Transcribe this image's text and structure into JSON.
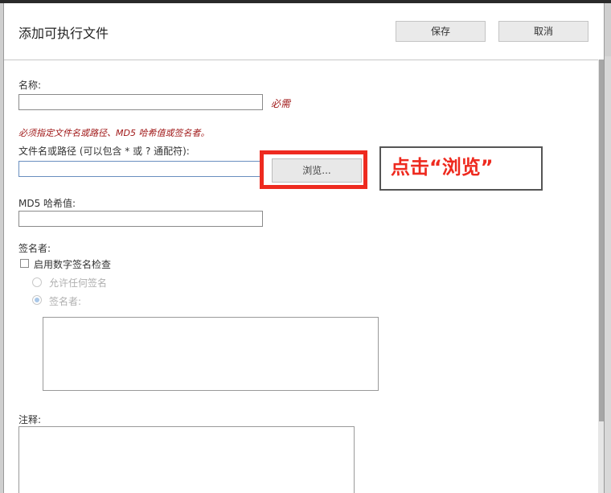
{
  "dialog": {
    "title": "添加可执行文件",
    "save_label": "保存",
    "cancel_label": "取消"
  },
  "form": {
    "name_label": "名称:",
    "name_value": "",
    "required_note": "必需",
    "must_specify_note": "必须指定文件名或路径、MD5 哈希值或签名者。",
    "path_label": "文件名或路径 (可以包含 * 或 ? 通配符):",
    "path_value": "",
    "browse_label": "浏览...",
    "md5_label": "MD5 哈希值:",
    "md5_value": "",
    "signer_section_label": "签名者:",
    "enable_signature_check_label": "启用数字签名检查",
    "enable_signature_check_checked": false,
    "allow_any_signature_label": "允许任何签名",
    "signer_option_label": "签名者:",
    "signer_option_selected": true,
    "signers_text": "",
    "notes_label": "注释:",
    "notes_text": ""
  },
  "annotation": {
    "callout_text": "点击“浏览”",
    "highlight_color": "#ee2a1f"
  }
}
